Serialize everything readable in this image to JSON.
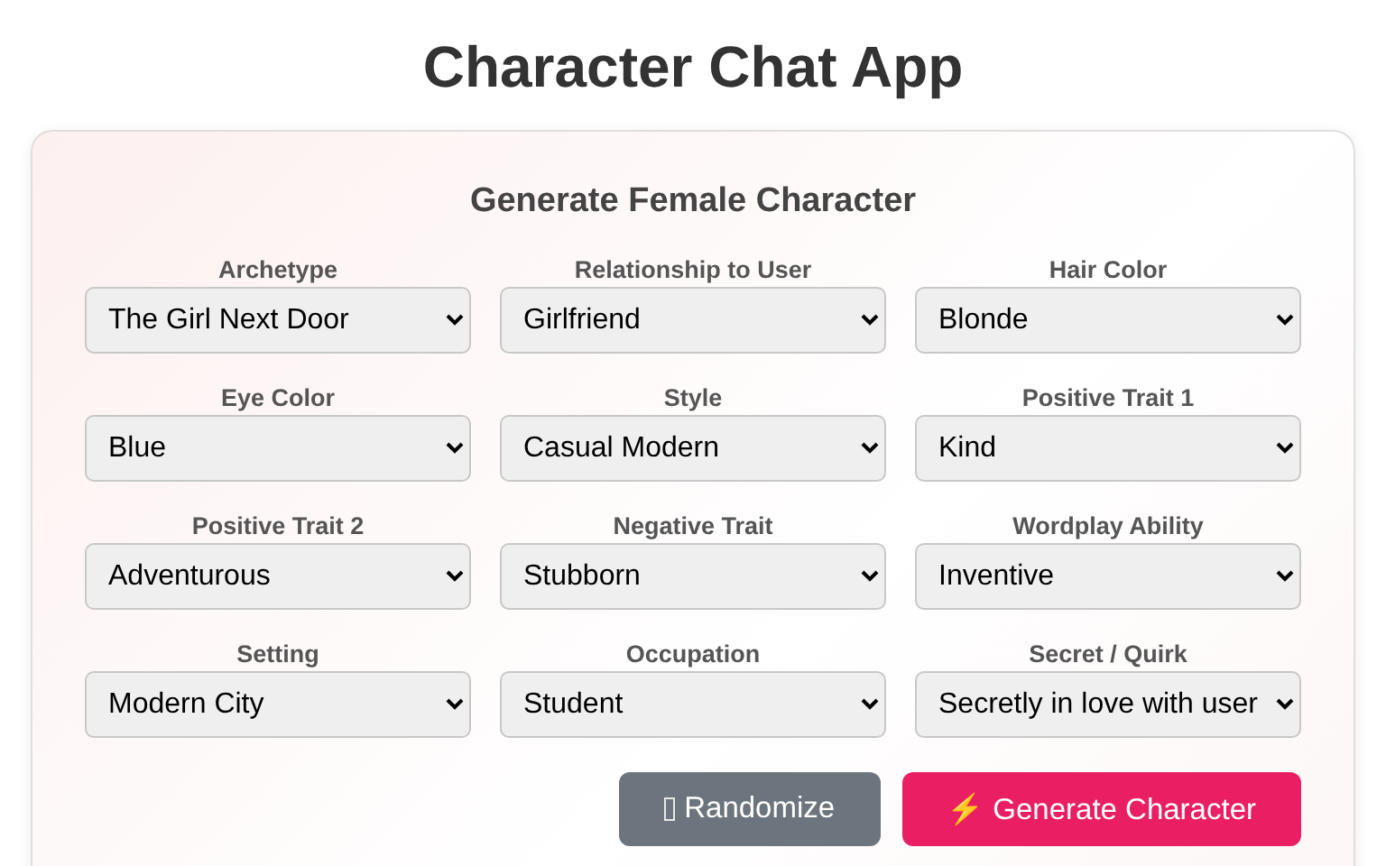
{
  "title": "Character Chat App",
  "card": {
    "heading": "Generate Female Character",
    "fields": [
      {
        "label": "Archetype",
        "value": "The Girl Next Door"
      },
      {
        "label": "Relationship to User",
        "value": "Girlfriend"
      },
      {
        "label": "Hair Color",
        "value": "Blonde"
      },
      {
        "label": "Eye Color",
        "value": "Blue"
      },
      {
        "label": "Style",
        "value": "Casual Modern"
      },
      {
        "label": "Positive Trait 1",
        "value": "Kind"
      },
      {
        "label": "Positive Trait 2",
        "value": "Adventurous"
      },
      {
        "label": "Negative Trait",
        "value": "Stubborn"
      },
      {
        "label": "Wordplay Ability",
        "value": "Inventive"
      },
      {
        "label": "Setting",
        "value": "Modern City"
      },
      {
        "label": "Occupation",
        "value": "Student"
      },
      {
        "label": "Secret / Quirk",
        "value": "Secretly in love with user"
      }
    ],
    "buttons": [
      {
        "kind": "secondary",
        "label": "Randomize",
        "icon": true
      },
      {
        "kind": "primary",
        "label": "⚡ Generate Character",
        "icon": false
      }
    ]
  }
}
